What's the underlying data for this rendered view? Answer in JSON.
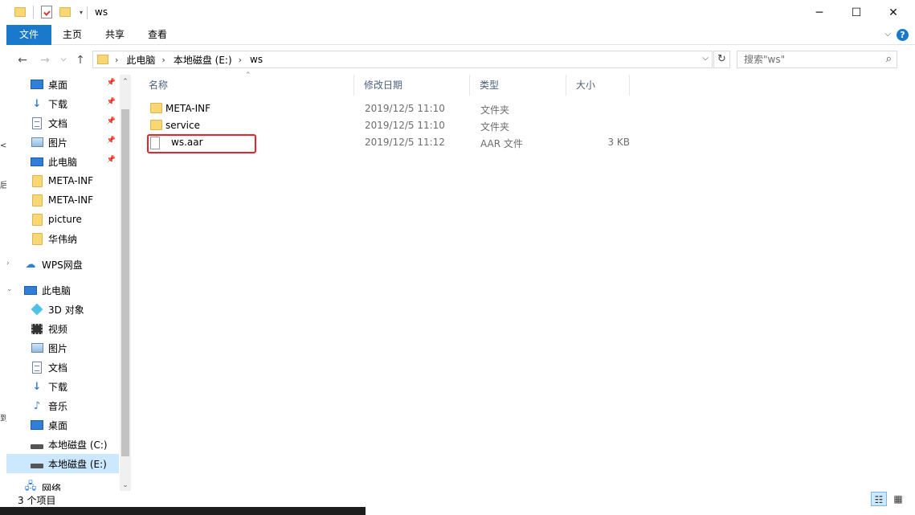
{
  "window": {
    "title": "ws",
    "controls": {
      "minimize": "─",
      "maximize": "☐",
      "close": "✕"
    }
  },
  "ribbon": {
    "tabs": [
      "文件",
      "主页",
      "共享",
      "查看"
    ],
    "help": "?"
  },
  "address": {
    "crumbs": [
      "此电脑",
      "本地磁盘 (E:)",
      "ws"
    ],
    "search_placeholder": "搜索\"ws\""
  },
  "navpane": {
    "quick_access": [
      {
        "label": "桌面",
        "icon": "desktop-icon",
        "pinned": true
      },
      {
        "label": "下载",
        "icon": "download-icon",
        "pinned": true
      },
      {
        "label": "文档",
        "icon": "document-icon",
        "pinned": true
      },
      {
        "label": "图片",
        "icon": "pictures-icon",
        "pinned": true
      },
      {
        "label": "此电脑",
        "icon": "computer-icon",
        "pinned": true
      },
      {
        "label": "META-INF",
        "icon": "folder-icon",
        "pinned": false
      },
      {
        "label": "META-INF",
        "icon": "folder-icon",
        "pinned": false
      },
      {
        "label": "picture",
        "icon": "folder-icon",
        "pinned": false
      },
      {
        "label": "华伟纳",
        "icon": "folder-icon",
        "pinned": false
      }
    ],
    "wps": "WPS网盘",
    "this_pc": "此电脑",
    "pc_items": [
      {
        "label": "3D 对象",
        "icon": "3d-objects-icon"
      },
      {
        "label": "视频",
        "icon": "video-icon"
      },
      {
        "label": "图片",
        "icon": "pictures-icon"
      },
      {
        "label": "文档",
        "icon": "document-icon"
      },
      {
        "label": "下载",
        "icon": "download-icon"
      },
      {
        "label": "音乐",
        "icon": "music-icon"
      },
      {
        "label": "桌面",
        "icon": "desktop-icon"
      },
      {
        "label": "本地磁盘 (C:)",
        "icon": "drive-icon"
      },
      {
        "label": "本地磁盘 (E:)",
        "icon": "drive-icon",
        "selected": true
      }
    ],
    "network": "网络"
  },
  "columns": {
    "name": "名称",
    "date": "修改日期",
    "type": "类型",
    "size": "大小"
  },
  "files": [
    {
      "name": "META-INF",
      "date": "2019/12/5 11:10",
      "type": "文件夹",
      "size": "",
      "icon": "folder-icon"
    },
    {
      "name": "service",
      "date": "2019/12/5 11:10",
      "type": "文件夹",
      "size": "",
      "icon": "folder-icon"
    },
    {
      "name": "ws.aar",
      "date": "2019/12/5 11:12",
      "type": "AAR 文件",
      "size": "3 KB",
      "icon": "file-icon",
      "highlighted": true
    }
  ],
  "status": {
    "count": "3 个项目"
  },
  "colors": {
    "accent": "#1979ca",
    "highlight_box": "#e8232b",
    "selected": "#cce8ff"
  }
}
